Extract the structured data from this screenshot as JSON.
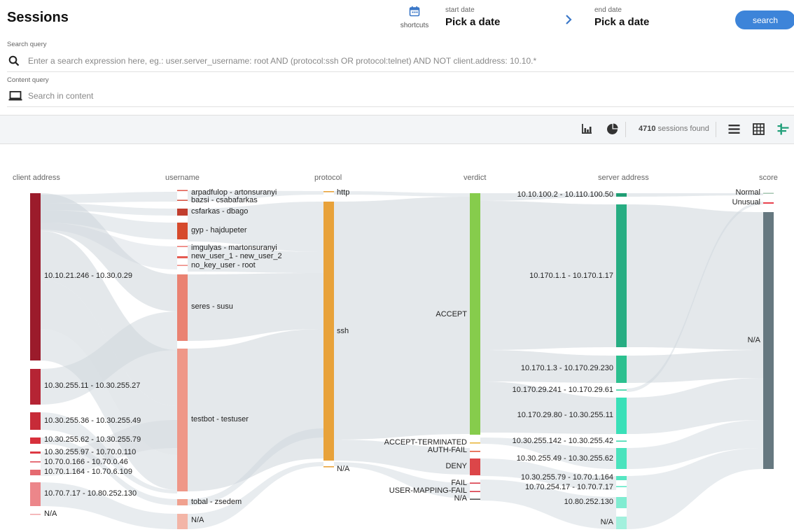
{
  "header": {
    "title": "Sessions",
    "shortcuts_label": "shortcuts",
    "start_date_label": "start date",
    "start_date_value": "Pick a date",
    "end_date_label": "end date",
    "end_date_value": "Pick a date",
    "search_button": "search"
  },
  "search_query": {
    "label": "Search query",
    "placeholder": "Enter a search expression here, eg.: user.server_username: root AND (protocol:ssh OR protocol:telnet) AND NOT client.address: 10.10.*"
  },
  "content_query": {
    "label": "Content query",
    "placeholder": "Search in content"
  },
  "toolbar": {
    "sessions_count": "4710",
    "sessions_suffix": " sessions found",
    "icons": [
      "bar-chart-icon",
      "pie-chart-icon",
      "list-view-icon",
      "table-view-icon",
      "sankey-view-icon"
    ]
  },
  "sankey": {
    "columns": [
      "client address",
      "username",
      "protocol",
      "verdict",
      "server address",
      "score"
    ],
    "client_nodes": [
      "10.10.21.246 - 10.30.0.29",
      "10.30.255.11 - 10.30.255.27",
      "10.30.255.36 - 10.30.255.49",
      "10.30.255.62 - 10.30.255.79",
      "10.30.255.97 - 10.70.0.110",
      "10.70.0.166 - 10.70.0.46",
      "10.70.1.164 - 10.70.6.109",
      "10.70.7.17 - 10.80.252.130",
      "N/A"
    ],
    "username_nodes": [
      "arpadfulop - artonsuranyi",
      "bazsi - csabafarkas",
      "csfarkas - dbago",
      "gyp - hajdupeter",
      "imgulyas - martonsuranyi",
      "new_user_1 - new_user_2",
      "no_key_user - root",
      "seres - susu",
      "testbot - testuser",
      "tobal - zsedem",
      "N/A"
    ],
    "protocol_nodes": [
      "http",
      "ssh",
      "N/A"
    ],
    "verdict_nodes": [
      "ACCEPT",
      "ACCEPT-TERMINATED",
      "AUTH-FAIL",
      "DENY",
      "FAIL",
      "USER-MAPPING-FAIL",
      "N/A"
    ],
    "server_nodes": [
      "10.10.100.2 - 10.110.100.50",
      "10.170.1.1 - 10.170.1.17",
      "10.170.1.3 - 10.170.29.230",
      "10.170.29.241 - 10.170.29.61",
      "10.170.29.80 - 10.30.255.11",
      "10.30.255.142 - 10.30.255.42",
      "10.30.255.49 - 10.30.255.62",
      "10.30.255.79 - 10.70.1.164",
      "10.70.254.17 - 10.70.7.17",
      "10.80.252.130",
      "N/A"
    ],
    "score_nodes": [
      "Normal",
      "Unusual",
      "N/A"
    ],
    "colors": {
      "link": "#cdd5db",
      "client": "#b52434",
      "username": "#ea8272",
      "protocol": "#e8a23a",
      "verdict_accept": "#86cc4c",
      "verdict_deny": "#dc4649",
      "server_dark": "#27ad82",
      "server_light": "#39e0b8",
      "score_na": "#667880",
      "score_normal": "#a8c9b5",
      "score_unusual": "#e8434e"
    }
  }
}
